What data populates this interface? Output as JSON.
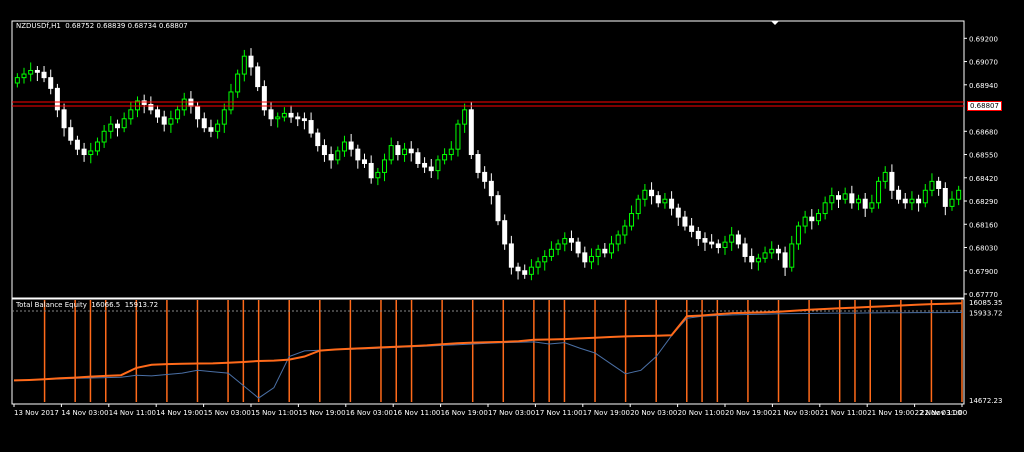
{
  "symbol_info": {
    "symbol": "NZDUSDf,H1",
    "open": "0.68752",
    "high": "0.68839",
    "low": "0.68734",
    "close": "0.68807"
  },
  "indicator_info": {
    "name": "Total Balance Equity",
    "value1": "16066.5",
    "value2": "15913.72"
  },
  "colors": {
    "background": "#000000",
    "axis": "#ffffff",
    "bull": "#00ff00",
    "bear": "#ffffff",
    "price_line": "#ff0000",
    "balance": "#ff6a1a",
    "equity": "#4a6fa5",
    "deals": "#ff6a1a"
  },
  "chart_data": [
    {
      "type": "candlestick",
      "title": "NZDUSDf,H1",
      "ylim": [
        0.6777,
        0.6928
      ],
      "y_ticks": [
        "0.69200",
        "0.69070",
        "0.68940",
        "0.68807",
        "0.68680",
        "0.68550",
        "0.68420",
        "0.68290",
        "0.68160",
        "0.68030",
        "0.67900",
        "0.67770"
      ],
      "current_price": "0.68807",
      "x_ticks": [
        "13 Nov 2017",
        "14 Nov 03:00",
        "14 Nov 11:00",
        "14 Nov 19:00",
        "15 Nov 03:00",
        "15 Nov 11:00",
        "15 Nov 19:00",
        "16 Nov 03:00",
        "16 Nov 11:00",
        "16 Nov 19:00",
        "17 Nov 03:00",
        "17 Nov 11:00",
        "17 Nov 19:00",
        "20 Nov 03:00",
        "20 Nov 11:00",
        "20 Nov 19:00",
        "21 Nov 03:00",
        "21 Nov 11:00",
        "21 Nov 19:00",
        "22 Nov 03:00",
        "22 Nov 11:00"
      ],
      "close_series": [
        0.6898,
        0.69,
        0.6902,
        0.6901,
        0.6898,
        0.6892,
        0.688,
        0.687,
        0.6863,
        0.6858,
        0.6855,
        0.6857,
        0.6862,
        0.6868,
        0.6872,
        0.687,
        0.6875,
        0.688,
        0.6885,
        0.6883,
        0.688,
        0.6876,
        0.6872,
        0.6875,
        0.688,
        0.6886,
        0.6882,
        0.6875,
        0.687,
        0.6868,
        0.6872,
        0.688,
        0.689,
        0.69,
        0.691,
        0.6904,
        0.6893,
        0.688,
        0.6875,
        0.6876,
        0.6878,
        0.6876,
        0.6875,
        0.6874,
        0.6867,
        0.686,
        0.6855,
        0.6852,
        0.6857,
        0.6862,
        0.6858,
        0.6852,
        0.685,
        0.6842,
        0.6845,
        0.6852,
        0.686,
        0.6855,
        0.6858,
        0.6856,
        0.685,
        0.6848,
        0.6846,
        0.6852,
        0.6855,
        0.6858,
        0.6872,
        0.688,
        0.6855,
        0.6845,
        0.684,
        0.6832,
        0.6818,
        0.6805,
        0.6792,
        0.679,
        0.6788,
        0.6792,
        0.6795,
        0.6798,
        0.6802,
        0.6805,
        0.6808,
        0.6806,
        0.68,
        0.6795,
        0.6798,
        0.6802,
        0.68,
        0.6805,
        0.681,
        0.6815,
        0.6822,
        0.683,
        0.6835,
        0.6832,
        0.6828,
        0.683,
        0.6825,
        0.682,
        0.6815,
        0.6812,
        0.6808,
        0.6806,
        0.6805,
        0.6803,
        0.6806,
        0.681,
        0.6805,
        0.6798,
        0.6795,
        0.6797,
        0.68,
        0.6802,
        0.68,
        0.6792,
        0.6805,
        0.6815,
        0.682,
        0.6818,
        0.6822,
        0.6828,
        0.6832,
        0.683,
        0.6833,
        0.6828,
        0.683,
        0.6825,
        0.6828,
        0.684,
        0.6845,
        0.6835,
        0.683,
        0.6828,
        0.683,
        0.6828,
        0.6835,
        0.684,
        0.6836,
        0.6826,
        0.683,
        0.6835
      ],
      "series": [
        {
          "name": "NZDUSDf,H1",
          "values": "close_series"
        }
      ]
    },
    {
      "type": "line",
      "title": "Total Balance Equity",
      "ylim": [
        14672.23,
        16085.35
      ],
      "y_ticks": [
        "16085.35",
        "15933.72",
        "14672.23"
      ],
      "balance": [
        14955,
        14960,
        14970,
        14985,
        14995,
        15010,
        15020,
        15030,
        15135,
        15180,
        15190,
        15195,
        15198,
        15200,
        15210,
        15220,
        15235,
        15240,
        15255,
        15300,
        15385,
        15400,
        15410,
        15420,
        15430,
        15440,
        15450,
        15460,
        15475,
        15490,
        15500,
        15505,
        15510,
        15520,
        15540,
        15545,
        15550,
        15560,
        15570,
        15580,
        15590,
        15595,
        15600,
        15605,
        15880,
        15890,
        15910,
        15925,
        15930,
        15935,
        15945,
        15960,
        15975,
        15985,
        15995,
        16005,
        16015,
        16025,
        16035,
        16045,
        16055,
        16060,
        16066
      ],
      "equity": [
        14950,
        14960,
        14970,
        14975,
        14985,
        14990,
        14995,
        15000,
        15030,
        15020,
        15040,
        15060,
        15100,
        15080,
        15060,
        14880,
        14700,
        14850,
        15300,
        15380,
        15390,
        15400,
        15405,
        15410,
        15420,
        15430,
        15440,
        15450,
        15460,
        15470,
        15480,
        15490,
        15500,
        15505,
        15510,
        15480,
        15500,
        15420,
        15350,
        15200,
        15050,
        15100,
        15300,
        15600,
        15850,
        15880,
        15890,
        15900,
        15905,
        15910,
        15915,
        15918,
        15920,
        15922,
        15925,
        15926,
        15928,
        15930,
        15931,
        15932,
        15933,
        15933,
        15934
      ]
    }
  ]
}
